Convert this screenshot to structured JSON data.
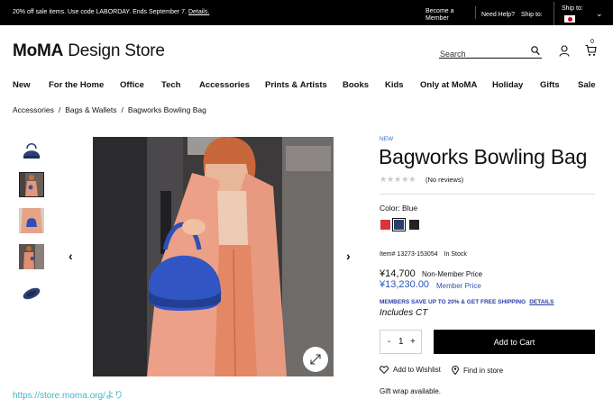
{
  "promo": {
    "message": "20% off sale items. Use code LABORDAY. Ends September 7.",
    "details_link": "Details.",
    "become_member": "Become a Member",
    "need_help": "Need Help?",
    "ship_to": "Ship to:",
    "ship_to_box": "Ship to:"
  },
  "header": {
    "logo_bold": "MoMA",
    "logo_rest": " Design Store",
    "search_placeholder": "Search",
    "cart_count": "0"
  },
  "nav": {
    "items": [
      "New",
      "For the Home",
      "Office",
      "Tech",
      "Accessories",
      "Prints & Artists",
      "Books",
      "Kids",
      "Only at MoMA",
      "Holiday",
      "Gifts",
      "Sale"
    ]
  },
  "breadcrumb": {
    "items": [
      "Accessories",
      "Bags & Wallets",
      "Bagworks Bowling Bag"
    ],
    "separator": "/"
  },
  "gallery": {
    "prev_arrow": "‹",
    "next_arrow": "›"
  },
  "credit": "https://store.moma.org/より",
  "product": {
    "tag": "NEW",
    "title": "Bagworks Bowling Bag",
    "stars": "★★★★★",
    "rating": 0,
    "reviews": "(No reviews)",
    "color_label": "Color: Blue",
    "swatches": [
      {
        "name": "red",
        "color": "#d9343e"
      },
      {
        "name": "blue",
        "color": "#2e3c6e"
      },
      {
        "name": "black",
        "color": "#222222"
      }
    ],
    "item_number": "Item# 13273-153054",
    "stock": "In Stock",
    "non_member_price": "¥14,700",
    "non_member_label": "Non-Member Price",
    "member_price": "¥13,230.00",
    "member_label": "Member Price",
    "members_promo": "MEMBERS SAVE UP TO 20% & GET FREE SHIPPING",
    "members_details": "DETAILS",
    "includes": "Includes CT",
    "qty_minus": "-",
    "qty_value": "1",
    "qty_plus": "+",
    "add_to_cart": "Add to Cart",
    "add_to_wishlist": "Add to Wishlist",
    "find_in_store": "Find in store",
    "gift_wrap": "Gift wrap available."
  },
  "colors": {
    "accent_blue": "#2a56b8",
    "promo_bg": "#000000",
    "credit_teal": "#48b4c8"
  }
}
